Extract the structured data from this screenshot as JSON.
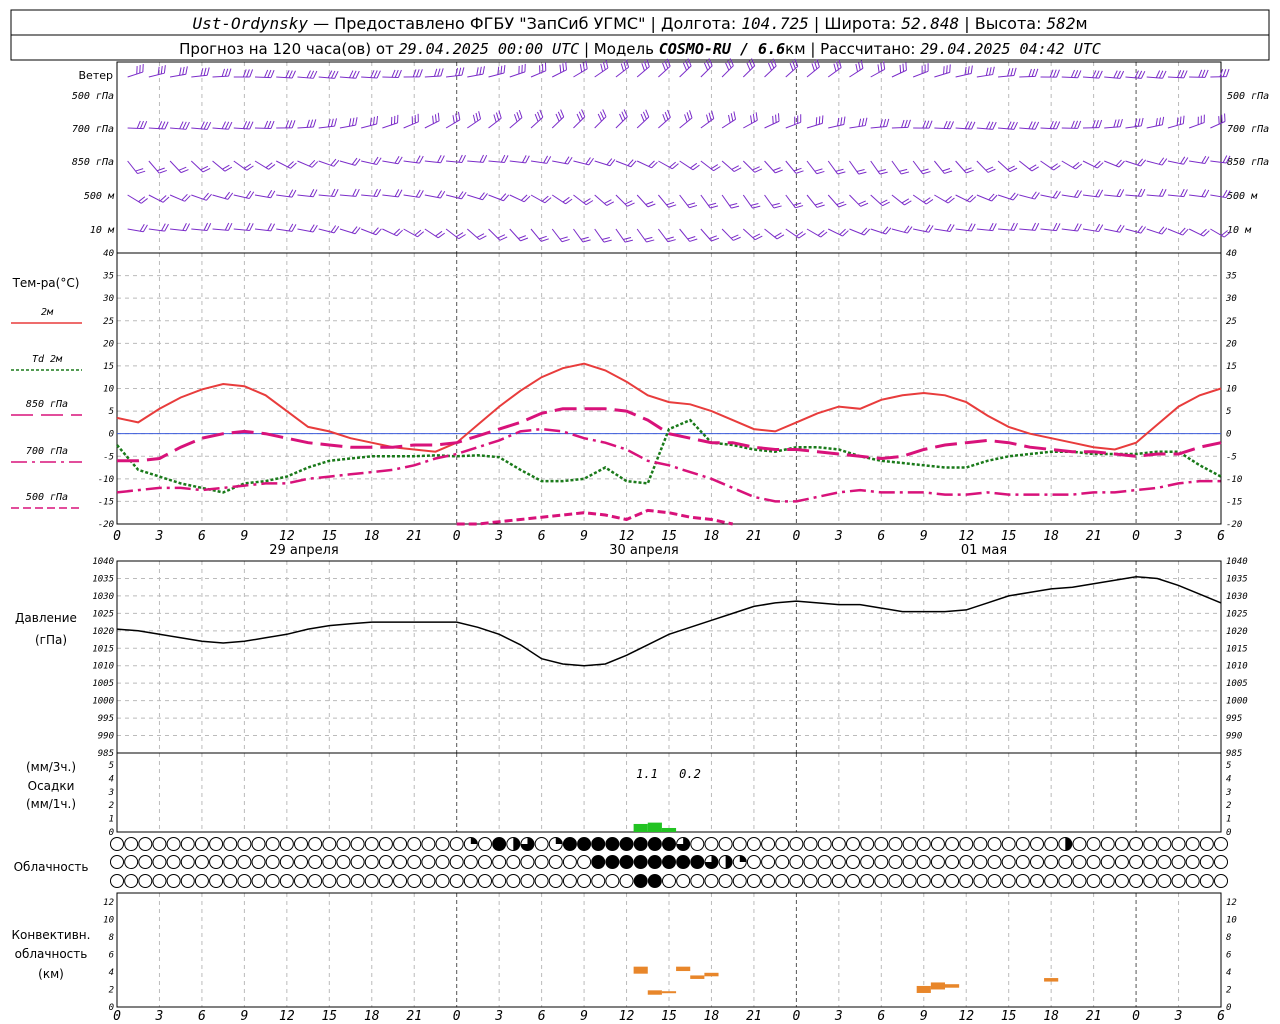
{
  "header": {
    "station": "Ust-Ordynsky",
    "line1_sep1": " — Предоставлено ФГБУ \"ЗапСиб УГМС\" | Долгота: ",
    "lon": "104.725",
    "line1_sep2": " | Широта: ",
    "lat": "52.848",
    "line1_sep3": " | Высота: ",
    "alt": "582",
    "alt_unit": "м",
    "line2_a": "Прогноз на 120 часа(ов) от ",
    "issued": "29.04.2025 00:00 UTC",
    "line2_b": " | Модель ",
    "model": "COSMO-RU / 6.6",
    "model_unit": "км",
    "line2_c": " | Рассчитано: ",
    "computed": "29.04.2025 04:42 UTC"
  },
  "wind_panel": {
    "title": "Ветер",
    "levels": [
      "500 гПа",
      "700 гПа",
      "850 гПа",
      "500 м",
      "10   м"
    ],
    "levels_right": [
      "500 гПа",
      "700 гПа",
      "850 гПа",
      "500 м",
      "10   м"
    ],
    "color": "#7b2cc9"
  },
  "temp_panel": {
    "title": "Тем-ра(°С)",
    "legend": [
      {
        "label": "2м",
        "color": "#e83c3c",
        "dash": "solid"
      },
      {
        "label": "Td 2м",
        "color": "#1a7a1a",
        "dash": "dot"
      },
      {
        "label": "850 гПа",
        "color": "#d8127a",
        "dash": "longdash"
      },
      {
        "label": "700 гПа",
        "color": "#d8127a",
        "dash": "dashdot"
      },
      {
        "label": "500 гПа",
        "color": "#d8127a",
        "dash": "shortdash"
      }
    ],
    "yticks": [
      "40",
      "35",
      "30",
      "25",
      "20",
      "15",
      "10",
      "5",
      "0",
      "-5",
      "-10",
      "-15",
      "-20"
    ],
    "xticks": [
      "0",
      "3",
      "6",
      "9",
      "12",
      "15",
      "18",
      "21",
      "0",
      "3",
      "6",
      "9",
      "12",
      "15",
      "18",
      "21",
      "0",
      "3",
      "6",
      "9",
      "12",
      "15",
      "18",
      "21",
      "0",
      "3",
      "6"
    ],
    "days": [
      "29 апреля",
      "30 апреля",
      "01 мая"
    ]
  },
  "pressure_panel": {
    "title1": "Давление",
    "title2": "(гПа)",
    "yticks": [
      "1040",
      "1035",
      "1030",
      "1025",
      "1020",
      "1015",
      "1010",
      "1005",
      "1000",
      "995",
      "990",
      "985"
    ]
  },
  "precip_panel": {
    "title1": "(мм/3ч.)",
    "title2": "Осадки",
    "title3": "(мм/1ч.)",
    "yticks": [
      "5",
      "4",
      "3",
      "2",
      "1",
      "0"
    ],
    "totals": [
      "1.1",
      "0.2"
    ]
  },
  "cloud_panel": {
    "title": "Облачность"
  },
  "conv_panel": {
    "title1": "Конвективн.",
    "title2": "облачность",
    "title3": "(км)",
    "yticks": [
      "12",
      "10",
      "8",
      "6",
      "4",
      "2",
      "0"
    ],
    "xticks": [
      "0",
      "3",
      "6",
      "9",
      "12",
      "15",
      "18",
      "21",
      "0",
      "3",
      "6",
      "9",
      "12",
      "15",
      "18",
      "21",
      "0",
      "3",
      "6",
      "9",
      "12",
      "15",
      "18",
      "21",
      "0",
      "3",
      "6"
    ]
  },
  "chart_data": {
    "type": "line",
    "x_hours_utc_from_29_04_2025_00": [
      0,
      1.5,
      3,
      4.5,
      6,
      7.5,
      9,
      10.5,
      12,
      13.5,
      15,
      16.5,
      18,
      19.5,
      21,
      22.5,
      24,
      25.5,
      27,
      28.5,
      30,
      31.5,
      33,
      34.5,
      36,
      37.5,
      39,
      40.5,
      42,
      43.5,
      45,
      46.5,
      48,
      49.5,
      51,
      52.5,
      54,
      55.5,
      57,
      58.5,
      60,
      61.5,
      63,
      64.5,
      66,
      67.5,
      69,
      70.5,
      72,
      73.5,
      75,
      76.5,
      78
    ],
    "temperature": {
      "ylim": [
        -20,
        40
      ],
      "series": [
        {
          "name": "2м",
          "values": [
            3.5,
            2.5,
            5.5,
            8,
            9.8,
            11,
            10.5,
            8.5,
            5,
            1.5,
            0.5,
            -1,
            -2,
            -3,
            -3.5,
            -4,
            -2,
            2,
            6,
            9.5,
            12.5,
            14.5,
            15.5,
            14,
            11.5,
            8.5,
            7,
            6.5,
            5,
            3,
            1,
            0.5,
            2.5,
            4.5,
            6,
            5.5,
            7.5,
            8.5,
            9,
            8.5,
            7,
            4,
            1.5,
            0,
            -1,
            -2,
            -3,
            -3.5,
            -2,
            2,
            6,
            8.5,
            10
          ]
        },
        {
          "name": "Td 2м",
          "values": [
            -2.5,
            -8,
            -9.5,
            -11,
            -12,
            -13,
            -11,
            -10.5,
            -9.5,
            -7.5,
            -6,
            -5.5,
            -5,
            -5,
            -5,
            -4.8,
            -5,
            -4.8,
            -5.2,
            -8,
            -10.5,
            -10.5,
            -10,
            -7.5,
            -10.5,
            -11,
            1,
            3,
            -2,
            -2.5,
            -3.5,
            -4,
            -3,
            -3,
            -3.5,
            -5,
            -6,
            -6.5,
            -7,
            -7.5,
            -7.5,
            -6,
            -5,
            -4.5,
            -4,
            -4,
            -4.5,
            -4.5,
            -4.5,
            -4,
            -4,
            -7,
            -9.5
          ]
        },
        {
          "name": "850 гПа",
          "values": [
            -6,
            -6,
            -5.5,
            -3,
            -1,
            0,
            0.5,
            0,
            -1,
            -2,
            -2.5,
            -3,
            -3,
            -3,
            -2.5,
            -2.5,
            -2,
            -0.5,
            1,
            2.5,
            4.5,
            5.5,
            5.5,
            5.5,
            5,
            3,
            0,
            -1,
            -2,
            -2,
            -3,
            -3.5,
            -3.5,
            -4,
            -4.5,
            -5,
            -5.5,
            -5,
            -3.5,
            -2.5,
            -2,
            -1.5,
            -2,
            -3,
            -3.5,
            -4,
            -4,
            -4.5,
            -5,
            -4.5,
            -4.5,
            -3,
            -2
          ]
        },
        {
          "name": "700 гПа",
          "values": [
            -13,
            -12.5,
            -12,
            -12,
            -12.5,
            -12,
            -11.5,
            -11,
            -11,
            -10,
            -9.5,
            -9,
            -8.5,
            -8,
            -7,
            -5.5,
            -4.5,
            -3,
            -1.5,
            0.5,
            1,
            0.5,
            -1,
            -2,
            -3.5,
            -6,
            -7,
            -8.5,
            -10,
            -12,
            -14,
            -15,
            -15,
            -14,
            -13,
            -12.5,
            -13,
            -13,
            -13,
            -13.5,
            -13.5,
            -13,
            -13.5,
            -13.5,
            -13.5,
            -13.5,
            -13,
            -13,
            -12.5,
            -12,
            -11,
            -10.5,
            -10.5
          ]
        },
        {
          "name": "500 гПа",
          "values": [
            null,
            null,
            null,
            null,
            null,
            null,
            null,
            null,
            null,
            null,
            null,
            null,
            null,
            null,
            null,
            null,
            -20,
            -20,
            -19.5,
            -19,
            -18.5,
            -18,
            -17.5,
            -18,
            -19,
            -17,
            -17.5,
            -18.5,
            -19,
            -20,
            null,
            null,
            null,
            null,
            null,
            null,
            null,
            null,
            null,
            null,
            null,
            null,
            null,
            null,
            null,
            null,
            null,
            null,
            null,
            null,
            null,
            null,
            null
          ]
        }
      ]
    },
    "pressure": {
      "ylim": [
        985,
        1040
      ],
      "series": [
        {
          "name": "Давление",
          "values": [
            1020.5,
            1020,
            1019,
            1018,
            1017,
            1016.5,
            1017,
            1018,
            1019,
            1020.5,
            1021.5,
            1022,
            1022.5,
            1022.5,
            1022.5,
            1022.5,
            1022.5,
            1021,
            1019,
            1016,
            1012,
            1010.5,
            1010,
            1010.5,
            1013,
            1016,
            1019,
            1021,
            1023,
            1025,
            1027,
            1028,
            1028.5,
            1028,
            1027.5,
            1027.5,
            1026.5,
            1025.5,
            1025.5,
            1025.5,
            1026,
            1028,
            1030,
            1031,
            1032,
            1032.5,
            1033.5,
            1034.5,
            1035.5,
            1035,
            1033,
            1030.5,
            1028
          ]
        }
      ]
    },
    "precipitation": {
      "ylim": [
        0,
        5
      ],
      "bars_hourly_mm": [
        {
          "hour": 37,
          "value": 0.6
        },
        {
          "hour": 38,
          "value": 0.7
        },
        {
          "hour": 39,
          "value": 0.3
        }
      ],
      "totals_3h_mm": [
        {
          "hour": 37.5,
          "value": 1.1
        },
        {
          "hour": 40.5,
          "value": 0.2
        }
      ]
    },
    "cloud_cover_rows": {
      "hours": [
        0,
        1,
        2,
        3,
        4,
        5,
        6,
        7,
        8,
        9,
        10,
        11,
        12,
        13,
        14,
        15,
        16,
        17,
        18,
        19,
        20,
        21,
        22,
        23,
        24,
        25,
        26,
        27,
        28,
        29,
        30,
        31,
        32,
        33,
        34,
        35,
        36,
        37,
        38,
        39,
        40,
        41,
        42,
        43,
        44,
        45,
        46,
        47,
        48,
        49,
        50,
        51,
        52,
        53,
        54,
        55,
        56,
        57,
        58,
        59,
        60,
        61,
        62,
        63,
        64,
        65,
        66,
        67,
        68,
        69,
        70,
        71,
        72,
        73,
        74,
        75,
        76,
        77,
        78
      ],
      "upper": [
        0,
        0,
        0,
        0,
        0,
        0,
        0,
        0,
        0,
        0,
        0,
        0,
        0,
        0,
        0,
        0,
        0,
        0,
        0,
        0,
        0,
        0,
        0,
        0,
        0,
        0.25,
        0,
        1,
        0.5,
        0.75,
        0,
        0.25,
        1,
        1,
        1,
        1,
        1,
        1,
        1,
        1,
        0.75,
        0,
        0,
        0,
        0,
        0,
        0,
        0,
        0,
        0,
        0,
        0,
        0,
        0,
        0,
        0,
        0,
        0,
        0,
        0,
        0,
        0,
        0,
        0,
        0,
        0,
        0,
        0.5,
        0,
        0,
        0,
        0,
        0,
        0,
        0,
        0,
        0,
        0,
        0
      ],
      "middle": [
        0,
        0,
        0,
        0,
        0,
        0,
        0,
        0,
        0,
        0,
        0,
        0,
        0,
        0,
        0,
        0,
        0,
        0,
        0,
        0,
        0,
        0,
        0,
        0,
        0,
        0,
        0,
        0,
        0,
        0,
        0,
        0,
        0,
        0,
        1,
        1,
        1,
        1,
        1,
        1,
        1,
        1,
        0.75,
        0.5,
        0.25,
        0,
        0,
        0,
        0,
        0,
        0,
        0,
        0,
        0,
        0,
        0,
        0,
        0,
        0,
        0,
        0,
        0,
        0,
        0,
        0,
        0,
        0,
        0,
        0,
        0,
        0,
        0,
        0,
        0,
        0,
        0,
        0,
        0,
        0
      ],
      "lower": [
        0,
        0,
        0,
        0,
        0,
        0,
        0,
        0,
        0,
        0,
        0,
        0,
        0,
        0,
        0,
        0,
        0,
        0,
        0,
        0,
        0,
        0,
        0,
        0,
        0,
        0,
        0,
        0,
        0,
        0,
        0,
        0,
        0,
        0,
        0,
        0,
        0,
        1,
        1,
        0,
        0,
        0,
        0,
        0,
        0,
        0,
        0,
        0,
        0,
        0,
        0,
        0,
        0,
        0,
        0,
        0,
        0,
        0,
        0,
        0,
        0,
        0,
        0,
        0,
        0,
        0,
        0,
        0,
        0,
        0,
        0,
        0,
        0,
        0,
        0,
        0,
        0,
        0,
        0,
        0,
        0,
        0,
        0
      ]
    },
    "convective_cloud_km": {
      "ylim": [
        0,
        13
      ],
      "segments": [
        {
          "start": 36.5,
          "end": 37.5,
          "bottom": 3.8,
          "top": 4.6
        },
        {
          "start": 37.5,
          "end": 38.5,
          "bottom": 1.4,
          "top": 1.9
        },
        {
          "start": 38.5,
          "end": 39.5,
          "bottom": 1.6,
          "top": 1.8
        },
        {
          "start": 39.5,
          "end": 40.5,
          "bottom": 4.1,
          "top": 4.6
        },
        {
          "start": 40.5,
          "end": 41.5,
          "bottom": 3.2,
          "top": 3.6
        },
        {
          "start": 41.5,
          "end": 42.5,
          "bottom": 3.5,
          "top": 3.9
        },
        {
          "start": 56.5,
          "end": 57.5,
          "bottom": 1.6,
          "top": 2.4
        },
        {
          "start": 57.5,
          "end": 58.5,
          "bottom": 2.0,
          "top": 2.8
        },
        {
          "start": 58.5,
          "end": 59.5,
          "bottom": 2.2,
          "top": 2.6
        },
        {
          "start": 65.5,
          "end": 66.5,
          "bottom": 2.9,
          "top": 3.3
        }
      ]
    },
    "wind_barbs_levels": [
      "500 гПа",
      "700 гПа",
      "850 гПа",
      "500 м",
      "10 м"
    ]
  }
}
